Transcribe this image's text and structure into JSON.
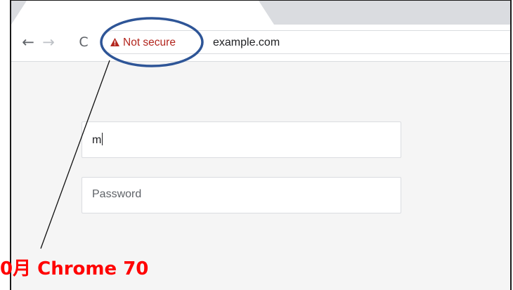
{
  "browser": {
    "nav": {
      "back_icon": "back-arrow-icon",
      "forward_icon": "forward-arrow-icon",
      "reload_icon": "reload-icon",
      "back_glyph": "←",
      "forward_glyph": "→",
      "reload_glyph": "C"
    },
    "omnibox": {
      "security_icon": "warning-triangle-icon",
      "security_label": "Not secure",
      "security_color": "#b3261e",
      "url": "example.com"
    }
  },
  "form": {
    "username_value": "m",
    "password_placeholder": "Password"
  },
  "annotation": {
    "caption": "0月 Chrome 70",
    "caption_color": "#ff0000",
    "ellipse_color": "#2e5597"
  }
}
